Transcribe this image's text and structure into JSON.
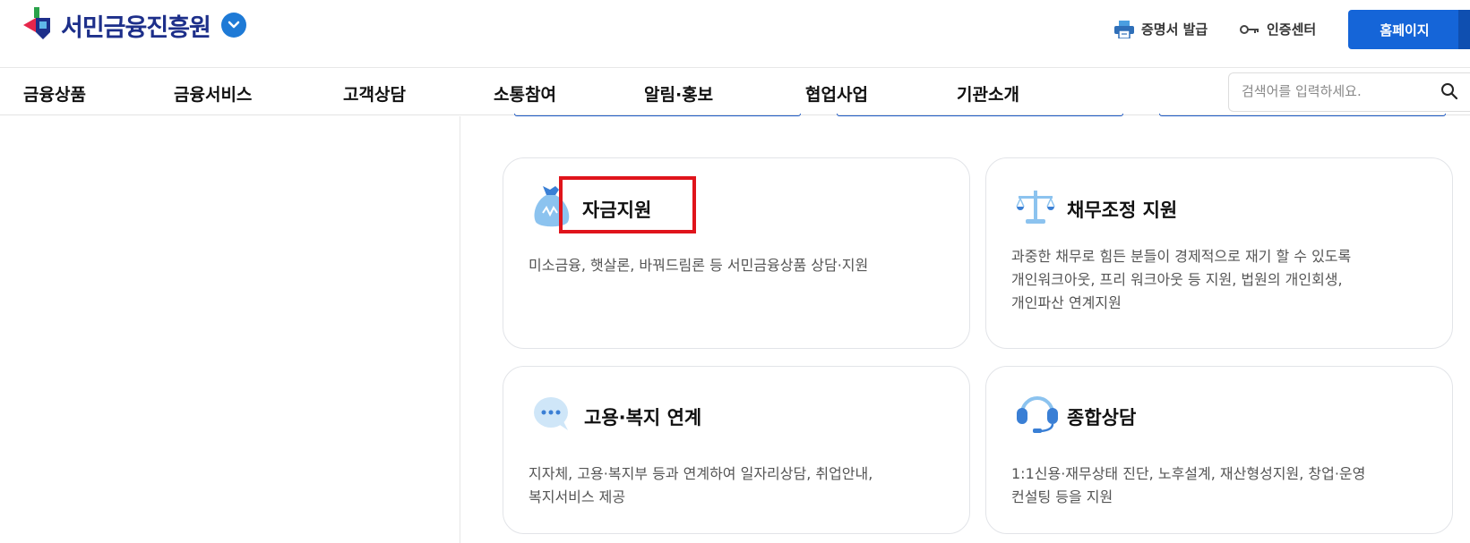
{
  "header": {
    "logo_text": "서민금융진흥원",
    "utility": [
      {
        "label": "증명서 발급",
        "icon": "printer-icon"
      },
      {
        "label": "인증센터",
        "icon": "key-icon"
      }
    ],
    "home_button": "홈페이지"
  },
  "gnb": {
    "items": [
      "금융상품",
      "금융서비스",
      "고객상담",
      "소통참여",
      "알림·홍보",
      "협업사업",
      "기관소개"
    ],
    "search_placeholder": "검색어를 입력하세요."
  },
  "cards": [
    {
      "title": "자금지원",
      "icon": "money-bag-icon",
      "description": [
        "미소금융, 햇살론, 바꿔드림론 등 서민금융상품 상담·지원"
      ]
    },
    {
      "title": "채무조정 지원",
      "icon": "scale-icon",
      "description": [
        "과중한 채무로 힘든 분들이 경제적으로 재기 할 수 있도록",
        "개인워크아웃, 프리 워크아웃 등 지원, 법원의 개인회생,",
        "개인파산 연계지원"
      ]
    },
    {
      "title": "고용·복지 연계",
      "icon": "chat-bubble-icon",
      "description": [
        "지자체, 고용·복지부 등과 연계하여 일자리상담, 취업안내,",
        "복지서비스 제공"
      ]
    },
    {
      "title": "종합상담",
      "icon": "headset-icon",
      "description": [
        "1:1신용·재무상태 진단, 노후설계, 재산형성지원, 창업·운영",
        "컨설팅 등을 지원"
      ]
    }
  ],
  "colors": {
    "brand_navy": "#1d2f8a",
    "primary_blue": "#1565d8",
    "highlight_red": "#e0141b",
    "icon_light_blue": "#8cc3ef"
  }
}
